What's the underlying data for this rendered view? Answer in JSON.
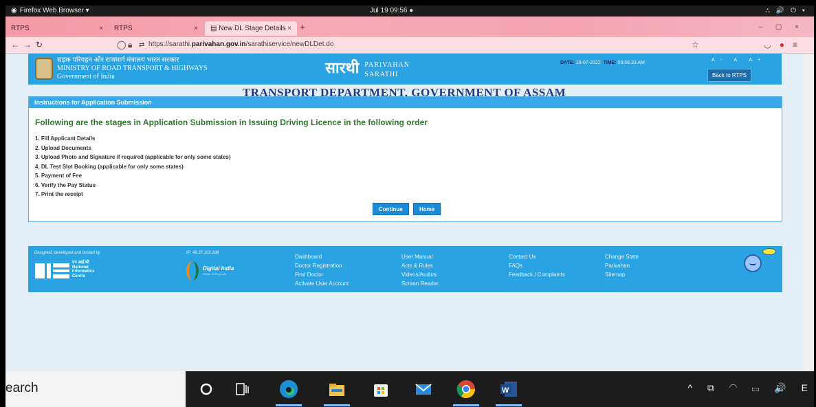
{
  "topbar": {
    "app_label": "Firefox Web Browser ▾",
    "clock": "Jul 19 09:56 ●",
    "sys_icons": "⛬ 🔊 ⏻ ▾"
  },
  "browser": {
    "tabs": [
      {
        "label": "RTPS",
        "active": false
      },
      {
        "label": "RTPS",
        "active": false
      },
      {
        "label": "New DL Stage Details",
        "active": true
      }
    ],
    "tab_close": "×",
    "new_tab": "+",
    "window_controls": "– ▢ ×",
    "url_prefix": "https://sarathi.",
    "url_domain": "parivahan.gov.in",
    "url_path": "/sarathiservice/newDLDet.do"
  },
  "header": {
    "ministry_hindi": "सड़क परिवहन और राजमार्ग मंत्रालय भारत सरकार",
    "ministry_en": "MINISTRY OF ROAD TRANSPORT & HIGHWAYS",
    "gov": "Government of India",
    "logo_hindi": "सारथी",
    "logo_line1": "PARIVAHAN",
    "logo_line2": "SARATHI",
    "date_label": "DATE:",
    "date_value": "19-07-2022",
    "time_label": "TIME:",
    "time_value": "09:56:33 AM",
    "font_controls": "A- A A+",
    "back_button": "Back to RTPS"
  },
  "dept_title": "TRANSPORT DEPARTMENT, GOVERNMENT OF ASSAM",
  "panel": {
    "heading": "Instructions for Application Submission",
    "lead": "Following are the stages in Application Submission in Issuing Driving Licence in the following order",
    "steps": [
      "1. Fill Applicant Details",
      "2. Upload Documents",
      "3. Upload Photo and Signature if required (applicable for only some states)",
      "4. DL Test Slot Booking (applicable for only some states)",
      "5. Payment of Fee",
      "6. Verify the Pay Status",
      "7. Print the receipt"
    ],
    "continue_button": "Continue",
    "home_button": "Home"
  },
  "footer": {
    "designed_by": "Designed, developed and hosted by",
    "ip": "IP: 49.37.102.188",
    "nic_hindi": "एन आई सी",
    "nic_lines": [
      "National",
      "Informatics",
      "Centre"
    ],
    "digital_india": "Digital India",
    "digital_india_sub": "Power To Empower",
    "col1": [
      "Dashboard",
      "Doctor Registration",
      "Find Doctor",
      "Activate User Account"
    ],
    "col2": [
      "User Manual",
      "Acts & Rules",
      "Videos/Audios",
      "Screen Reader"
    ],
    "col3": [
      "Contact Us",
      "FAQs",
      "Feedback / Complaints"
    ],
    "col4": [
      "Change State",
      "Parivahan",
      "Sitemap"
    ]
  },
  "taskbar": {
    "search_text": "earch",
    "tray": "^ ⧉ ◠ ▭ 🔊 E"
  }
}
